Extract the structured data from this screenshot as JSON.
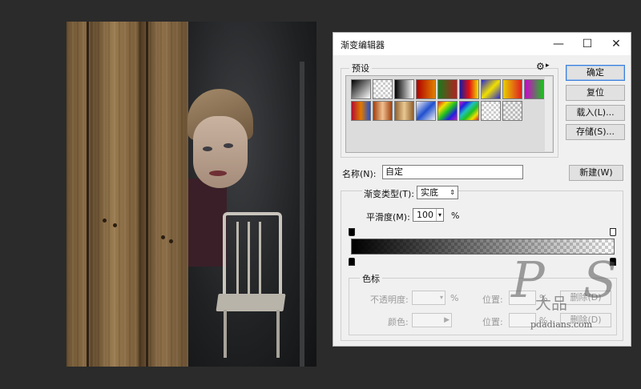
{
  "dialog": {
    "title": "渐变编辑器",
    "window_buttons": {
      "minimize": "—",
      "maximize": "☐",
      "close": "✕"
    }
  },
  "presets": {
    "label": "预设",
    "gear_icon": "⚙",
    "swatches": [
      "linear-gradient(135deg,#000,#fff)",
      "repeating-conic-gradient(#ccc 0% 25%, #fff 0% 50%) 0 0/6px 6px",
      "linear-gradient(90deg,#000,#fff)",
      "linear-gradient(90deg,#b00000,#e08000)",
      "linear-gradient(90deg,#1a7a1a,#b22020)",
      "linear-gradient(90deg,#1a1aa0,#e01010,#f0e000)",
      "linear-gradient(135deg,#2a2ad0,#f0e000,#2a2ad0)",
      "linear-gradient(90deg,#e8d000,#e02020)",
      "linear-gradient(90deg,#d000d0,#20c020)",
      "linear-gradient(90deg,#b01030,#e07a00,#2050d0)",
      "linear-gradient(90deg,#a04010,#f0c090,#a04010)",
      "linear-gradient(90deg,#906030,#e8c890,#906030)",
      "linear-gradient(135deg,#f0f0f0,#2050d0,#f0f0f0)",
      "linear-gradient(135deg,#e02020,#f0e000,#20c020,#2020e0,#c020c0)",
      "linear-gradient(135deg,#c020c0,#2020e0,#20c0c0,#20c020,#f0e000,#e02020)",
      "repeating-conic-gradient(#ccc 0% 25%, #fff 0% 50%) 0 0/6px 6px",
      "repeating-conic-gradient(#bbb 0% 25%, #eee 0% 50%) 0 0/6px 6px"
    ]
  },
  "buttons": {
    "ok": "确定",
    "reset": "复位",
    "load": "载入(L)...",
    "save": "存储(S)...",
    "new": "新建(W)"
  },
  "name_field": {
    "label": "名称(N):",
    "value": "自定"
  },
  "gradient_type": {
    "label": "渐变类型(T):",
    "value": "实底"
  },
  "smoothness": {
    "label": "平滑度(M):",
    "value": "100",
    "unit": "%"
  },
  "color_stops": {
    "label": "色标",
    "opacity_label": "不透明度:",
    "percent": "%",
    "location_label": "位置:",
    "delete_label": "删除(D)",
    "color_label": "颜色:"
  },
  "gradient": {
    "start_color": "#000000",
    "end_color": "#ffffff"
  },
  "watermark": {
    "text": "P S",
    "sub_text": "大品",
    "url": "pdadians.com"
  }
}
